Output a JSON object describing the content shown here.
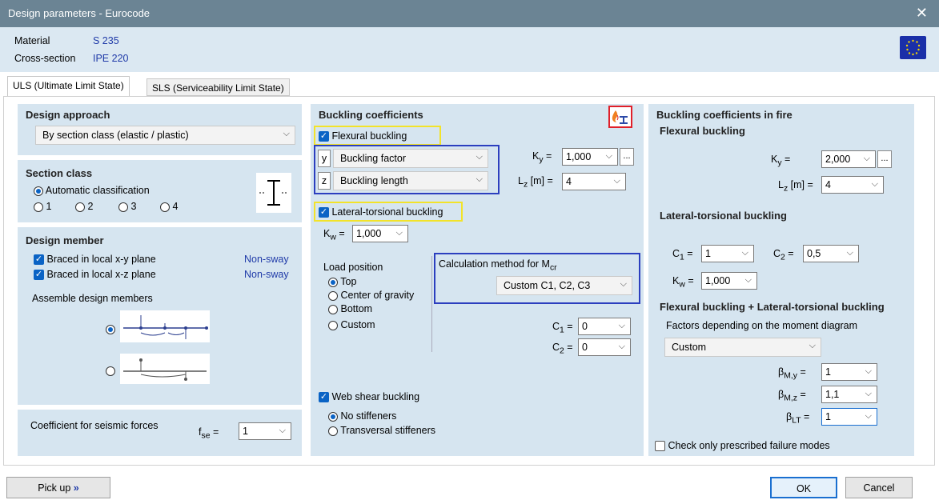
{
  "window": {
    "title": "Design parameters - Eurocode",
    "close": "✕"
  },
  "header": {
    "material_label": "Material",
    "material_value": "S 235",
    "section_label": "Cross-section",
    "section_value": "IPE 220"
  },
  "tabs": [
    {
      "label": "ULS (Ultimate Limit State)"
    },
    {
      "label": "SLS (Serviceability Limit State)"
    }
  ],
  "design_approach": {
    "title": "Design approach",
    "value": "By section class (elastic / plastic)"
  },
  "section_class": {
    "title": "Section class",
    "auto": "Automatic classification",
    "options": [
      "1",
      "2",
      "3",
      "4"
    ]
  },
  "design_member": {
    "title": "Design member",
    "xy": "Braced in local x-y plane",
    "xy_status": "Non-sway",
    "xz": "Braced in local x-z plane",
    "xz_status": "Non-sway",
    "assemble": "Assemble design members"
  },
  "seismic": {
    "label": "Coefficient for seismic forces",
    "var": "f",
    "sub": "se",
    "eq": " =",
    "value": "1"
  },
  "buckling": {
    "title": "Buckling coefficients",
    "flexural": "Flexural buckling",
    "y_axis": "y",
    "y_value": "Buckling factor",
    "z_axis": "z",
    "z_value": "Buckling length",
    "ky_label": "K",
    "ky_sub": "y",
    "ky_eq": " =",
    "ky_value": "1,000",
    "lz_label": "L",
    "lz_sub": "z",
    "lz_unit": " [m] =",
    "lz_value": "4",
    "ltb": "Lateral-torsional buckling",
    "kw_label": "K",
    "kw_sub": "w",
    "kw_eq": " =",
    "kw_value": "1,000",
    "load_position": "Load position",
    "lp_options": [
      "Top",
      "Center of gravity",
      "Bottom",
      "Custom"
    ],
    "calc_method_prefix": "Calculation method for M",
    "calc_method_sub": "cr",
    "calc_method_value": "Custom C1, C2, C3",
    "c1_label": "C",
    "c1_sub": "1",
    "c1_eq": " =",
    "c1_value": "0",
    "c2_label": "C",
    "c2_sub": "2",
    "c2_eq": " =",
    "c2_value": "0",
    "web": "Web shear buckling",
    "web_options": [
      "No stiffeners",
      "Transversal stiffeners"
    ]
  },
  "fire": {
    "title": "Buckling coefficients in fire",
    "flexural": "Flexural buckling",
    "ky_label": "K",
    "ky_sub": "y",
    "ky_eq": " =",
    "ky_value": "2,000",
    "lz_label": "L",
    "lz_sub": "z",
    "lz_unit": " [m] =",
    "lz_value": "4",
    "ltb": "Lateral-torsional buckling",
    "c1_label": "C",
    "c1_sub": "1",
    "c1_eq": " =",
    "c1_value": "1",
    "c2_label": "C",
    "c2_sub": "2",
    "c2_eq": " =",
    "c2_value": "0,5",
    "kw_label": "K",
    "kw_sub": "w",
    "kw_eq": " =",
    "kw_value": "1,000",
    "combined": "Flexural buckling + Lateral-torsional buckling",
    "factors": "Factors depending on the moment diagram",
    "factors_value": "Custom",
    "bmy_label": "β",
    "bmy_sub": "M,y",
    "bmy_eq": " =",
    "bmy_value": "1",
    "bmz_label": "β",
    "bmz_sub": "M,z",
    "bmz_eq": " =",
    "bmz_value": "1,1",
    "blt_label": "β",
    "blt_sub": "LT",
    "blt_eq": " =",
    "blt_value": "1",
    "prescribed": "Check only prescribed failure modes"
  },
  "footer": {
    "pickup": "Pick up",
    "pickup_arrow": "»",
    "ok": "OK",
    "cancel": "Cancel"
  },
  "colors": {
    "titlebar": "#6b8494",
    "panel": "#d6e5f0",
    "accent": "#0a63c5",
    "highlight_yellow": "#f2e32a",
    "highlight_blue": "#2c3fbf",
    "highlight_red": "#e0202a"
  }
}
